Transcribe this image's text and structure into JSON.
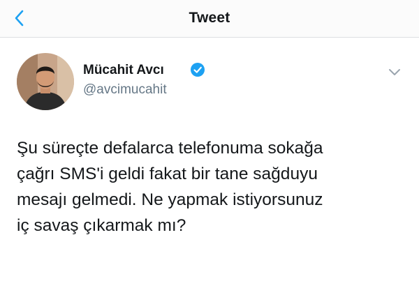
{
  "header": {
    "title": "Tweet",
    "back_icon": "chevron-left-icon"
  },
  "tweet": {
    "author_name": "Mücahit Avcı",
    "author_handle": "@avcimucahit",
    "verified_icon": "verified-badge-icon",
    "menu_icon": "chevron-down-icon",
    "text_lines": [
      "Şu süreçte defalarca telefonuma sokağa",
      "çağrı SMS'i geldi fakat bir tane sağduyu",
      "mesajı gelmedi. Ne yapmak istiyorsunuz",
      "iç savaş çıkarmak mı?"
    ]
  },
  "colors": {
    "accent": "#1da1f2",
    "text": "#14171a",
    "secondary_text": "#657786",
    "header_bg": "#fbfbfb"
  }
}
